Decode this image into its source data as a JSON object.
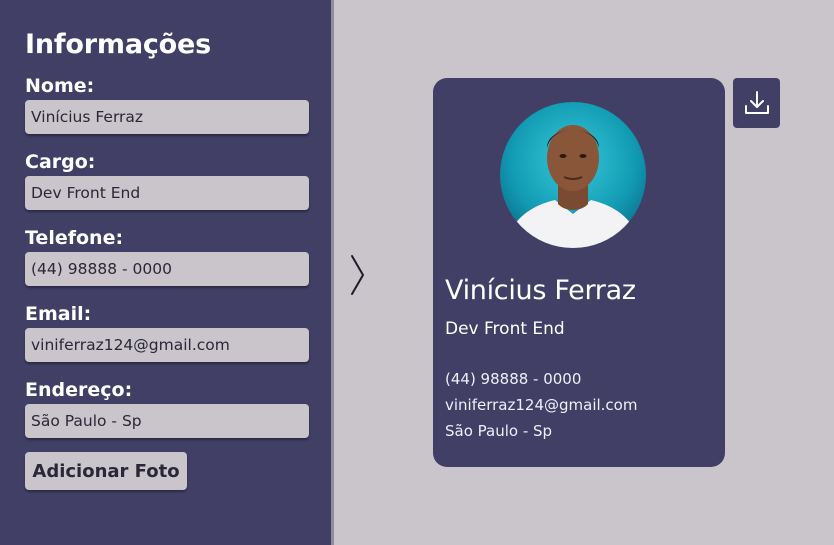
{
  "sidebar": {
    "title": "Informações",
    "fields": [
      {
        "label": "Nome:",
        "value": "Vinícius Ferraz"
      },
      {
        "label": "Cargo:",
        "value": "Dev Front End"
      },
      {
        "label": "Telefone:",
        "value": "(44) 98888 - 0000"
      },
      {
        "label": "Email:",
        "value": "viniferraz124@gmail.com"
      },
      {
        "label": "Endereço:",
        "value": "São Paulo - Sp"
      }
    ],
    "add_photo_label": "Adicionar Foto"
  },
  "card": {
    "name": "Vinícius Ferraz",
    "role": "Dev Front End",
    "phone": "(44) 98888 - 0000",
    "email": "viniferraz124@gmail.com",
    "address": "São Paulo - Sp"
  },
  "icons": {
    "arrow": "chevron-right-icon",
    "download": "download-icon"
  },
  "colors": {
    "panel": "#413f66",
    "background": "#c9c5cb",
    "input": "#c9c5cb",
    "text_light": "#ffffff"
  }
}
